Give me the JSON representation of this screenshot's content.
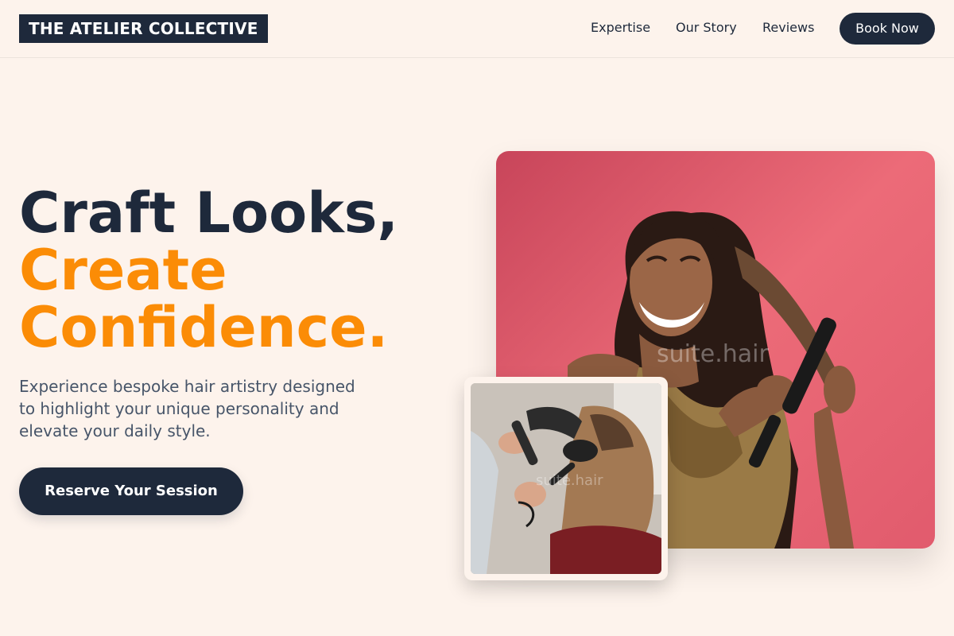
{
  "nav": {
    "logo": "THE ATELIER COLLECTIVE",
    "links": [
      "Expertise",
      "Our Story",
      "Reviews"
    ],
    "book_label": "Book Now"
  },
  "hero": {
    "headline_line1": "Craft Looks,",
    "headline_line2": "Create",
    "headline_line3": "Confidence.",
    "subtext": "Experience bespoke hair artistry designed to highlight your unique personality and elevate your daily style.",
    "cta_label": "Reserve Your Session"
  },
  "images": {
    "main_watermark": "suite.hair",
    "small_watermark": "suite.hair"
  },
  "colors": {
    "navy": "#1e293b",
    "accent_orange": "#fb8c06",
    "background": "#fdf3ec"
  }
}
